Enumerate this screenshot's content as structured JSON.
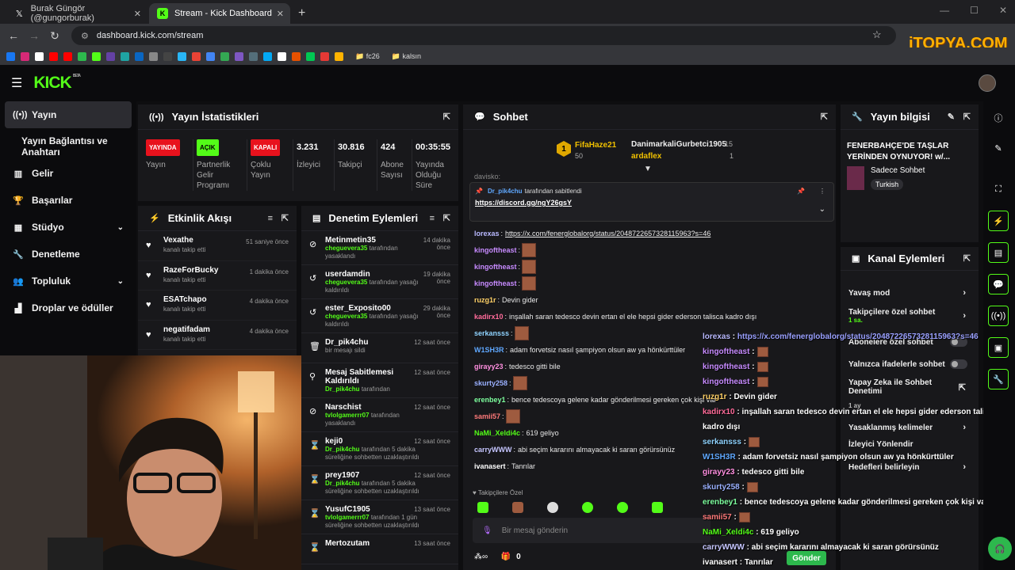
{
  "browser": {
    "tabs": [
      {
        "title": "Burak Güngör (@gungorburak)",
        "icon": "x-logo-icon"
      },
      {
        "title": "Stream - Kick Dashboard",
        "icon": "kick-logo-icon"
      }
    ],
    "url": "dashboard.kick.com/stream",
    "bookmark_folders": [
      "fc26",
      "kalsın"
    ],
    "watermark": "iTOPYA.COM"
  },
  "sidebar": {
    "items": [
      {
        "label": "Yayın",
        "icon": "broadcast-icon"
      },
      {
        "label": "Yayın Bağlantısı ve Anahtarı",
        "icon": ""
      },
      {
        "label": "Gelir",
        "icon": "revenue-icon"
      },
      {
        "label": "Başarılar",
        "icon": "trophy-icon"
      },
      {
        "label": "Stüdyo",
        "icon": "studio-icon"
      },
      {
        "label": "Denetleme",
        "icon": "wrench-icon"
      },
      {
        "label": "Topluluk",
        "icon": "community-icon"
      },
      {
        "label": "Droplar ve ödüller",
        "icon": "drops-icon"
      }
    ]
  },
  "stats_panel": {
    "title": "Yayın İstatistikleri",
    "stats": [
      {
        "badge": "YAYINDA",
        "label": "Yayın",
        "color": "#e8121d"
      },
      {
        "badge": "AÇIK",
        "label": "Partnerlik Gelir Programı",
        "color": "#53fc18"
      },
      {
        "badge": "KAPALI",
        "label": "Çoklu Yayın",
        "color": "#e8121d"
      },
      {
        "value": "3.231",
        "label": "İzleyici"
      },
      {
        "value": "30.816",
        "label": "Takipçi"
      },
      {
        "value": "424",
        "label": "Abone Sayısı"
      },
      {
        "value": "00:35:55",
        "label": "Yayında Olduğu Süre"
      }
    ]
  },
  "activity_panel": {
    "title": "Etkinlik Akışı",
    "items": [
      {
        "name": "Vexathe",
        "desc": "kanalı takip etti",
        "time": "51 saniye önce"
      },
      {
        "name": "RazeForBucky",
        "desc": "kanalı takip etti",
        "time": "1 dakika önce"
      },
      {
        "name": "ESATchapo",
        "desc": "kanalı takip etti",
        "time": "4 dakika önce"
      },
      {
        "name": "negatifadam",
        "desc": "kanalı takip etti",
        "time": "4 dakika önce"
      }
    ]
  },
  "mod_panel": {
    "title": "Denetim Eylemleri",
    "items": [
      {
        "name": "Metinmetin35",
        "mod": "cheguevera35",
        "desc": "tarafından yasaklandı",
        "time": "14 dakika önce",
        "icon": "ban-icon"
      },
      {
        "name": "userdamdin",
        "mod": "cheguevera35",
        "desc": "tarafından yasağı kaldırıldı",
        "time": "19 dakika önce",
        "icon": "undo-icon"
      },
      {
        "name": "ester_Exposito00",
        "mod": "cheguevera35",
        "desc": "tarafından yasağı kaldırıldı",
        "time": "29 dakika önce",
        "icon": "undo-icon"
      },
      {
        "name": "Dr_pik4chu",
        "mod": "",
        "desc": "bir mesajı sildi",
        "time": "12 saat önce",
        "icon": "trash-icon"
      },
      {
        "name": "Mesaj Sabitlemesi Kaldırıldı",
        "mod": "Dr_pik4chu",
        "desc": "tarafından",
        "time": "12 saat önce",
        "icon": "unpin-icon"
      },
      {
        "name": "Narschist",
        "mod": "tvlolgamerrr07",
        "desc": "tarafından yasaklandı",
        "time": "12 saat önce",
        "icon": "ban-icon"
      },
      {
        "name": "keji0",
        "mod": "Dr_pik4chu",
        "desc": "tarafından 5 dakika süreliğine sohbetten uzaklaştırıldı",
        "time": "12 saat önce",
        "icon": "hourglass-icon"
      },
      {
        "name": "prey1907",
        "mod": "Dr_pik4chu",
        "desc": "tarafından 5 dakika süreliğine sohbetten uzaklaştırıldı",
        "time": "12 saat önce",
        "icon": "hourglass-icon"
      },
      {
        "name": "YusufC1905",
        "mod": "tvlolgamerrr07",
        "desc": "tarafından 1 gün süreliğine sohbetten uzaklaştırıldı",
        "time": "13 saat önce",
        "icon": "hourglass-icon"
      },
      {
        "name": "Mertozutam",
        "mod": "",
        "desc": "",
        "time": "13 saat önce",
        "icon": "hourglass-icon"
      }
    ]
  },
  "chat_panel": {
    "title": "Sohbet",
    "leaderboard": [
      {
        "rank": "1",
        "name": "FifaHaze21",
        "count": "50"
      },
      {
        "name": "DanimarkaliGurbetci1905",
        "count": "15"
      },
      {
        "name": "ardaflex",
        "count": "1"
      }
    ],
    "pinned_by": "Dr_pik4chu",
    "pinned_by_text": "tarafından sabitlendi",
    "pinned_link": "https://discord.gg/ngY26gsY",
    "partial_top": "davisko:",
    "messages": [
      {
        "user": "lorexas",
        "text": "https://x.com/fenerglobalorg/status/2048722657328115963?s=46",
        "color": "#b9b9ff",
        "link": true
      },
      {
        "user": "kingoftheast",
        "text": "",
        "color": "#c78bff",
        "emote": true
      },
      {
        "user": "kingoftheast",
        "text": "",
        "color": "#c78bff",
        "emote": true
      },
      {
        "user": "kingoftheast",
        "text": "",
        "color": "#c78bff",
        "emote": true
      },
      {
        "user": "ruzg1r",
        "text": "Devin gider",
        "color": "#ffd166"
      },
      {
        "user": "kadirx10",
        "text": "inşallah saran tedesco devin ertan el ele hepsi gider ederson talisca kadro dışı",
        "color": "#ff6b9a"
      },
      {
        "user": "serkansss",
        "text": "",
        "color": "#8fd3ff",
        "emote": true
      },
      {
        "user": "W1SH3R",
        "text": "adam forvetsiz nasıl şampiyon olsun aw ya hönkürttüler",
        "color": "#5fa8ff"
      },
      {
        "user": "girayy23",
        "text": "tedesco gitti bile",
        "color": "#ff8fe0"
      },
      {
        "user": "skurty258",
        "text": "",
        "color": "#9ab0ff",
        "emote": true
      },
      {
        "user": "erenbey1",
        "text": "bence tedescoya gelene kadar gönderilmesi gereken çok kişi var",
        "color": "#7dff9e"
      },
      {
        "user": "samii57",
        "text": "",
        "color": "#ff7a7a",
        "emote": true
      },
      {
        "user": "NaMi_Xeldi4c",
        "text": "619 geliyo",
        "color": "#53fc18"
      },
      {
        "user": "carryWWW",
        "text": "abi seçim kararını almayacak ki saran görürsünüz",
        "color": "#c6c6ff"
      },
      {
        "user": "ivanasert",
        "text": "Tanrılar",
        "color": "#ffffff"
      }
    ],
    "followers_label": "Takipçilere Özel",
    "input_placeholder": "Bir mesaj gönderin",
    "viewer_count": "0",
    "send_label": "Gönder"
  },
  "overlay_chat": [
    {
      "user": "lorexas",
      "text": "https://x.com/fenerglobalorg/status/2048722657328115963?s=46",
      "color": "#b9b9ff"
    },
    {
      "user": "kingoftheast",
      "text": "",
      "color": "#c78bff",
      "emote": true
    },
    {
      "user": "kingoftheast",
      "text": "",
      "color": "#c78bff",
      "emote": true
    },
    {
      "user": "kingoftheast",
      "text": "",
      "color": "#c78bff",
      "emote": true
    },
    {
      "user": "ruzg1r",
      "text": "Devin gider",
      "color": "#ffd166"
    },
    {
      "user": "kadirx10",
      "text": "inşallah saran tedesco devin ertan el ele hepsi gider ederson talisca",
      "color": "#ff6b9a"
    },
    {
      "user": "",
      "text": "kadro dışı",
      "color": "#ffffff"
    },
    {
      "user": "serkansss",
      "text": "",
      "color": "#8fd3ff",
      "emote": true
    },
    {
      "user": "W1SH3R",
      "text": "adam forvetsiz nasıl şampiyon olsun aw ya hönkürttüler",
      "color": "#5fa8ff"
    },
    {
      "user": "girayy23",
      "text": "tedesco gitti bile",
      "color": "#ff8fe0"
    },
    {
      "user": "skurty258",
      "text": "",
      "color": "#9ab0ff",
      "emote": true
    },
    {
      "user": "erenbey1",
      "text": "bence tedescoya gelene kadar gönderilmesi gereken çok kişi var",
      "color": "#7dff9e"
    },
    {
      "user": "samii57",
      "text": "",
      "color": "#ff7a7a",
      "emote": true
    },
    {
      "user": "NaMi_Xeldi4c",
      "text": "619 geliyo",
      "color": "#53fc18"
    },
    {
      "user": "carryWWW",
      "text": "abi seçim kararını almayacak ki saran görürsünüz",
      "color": "#c6c6ff"
    },
    {
      "user": "ivanasert",
      "text": "Tanrılar",
      "color": "#ffffff"
    }
  ],
  "stream_info": {
    "title": "Yayın bilgisi",
    "stream_title": "FENERBAHÇE'DE TAŞLAR YERİNDEN OYNUYOR! w/...",
    "category": "Sadece Sohbet",
    "tag": "Turkish"
  },
  "channel_actions": {
    "title": "Kanal Eylemleri",
    "rows": [
      {
        "label": "Yavaş mod",
        "type": "chevron"
      },
      {
        "label": "Takipçilere özel sohbet",
        "sub": "1 sa.",
        "type": "chevron"
      },
      {
        "label": "Abonelere özel sohbet",
        "type": "toggle"
      },
      {
        "label": "Yalnızca ifadelerle sohbet",
        "type": "toggle"
      },
      {
        "label": "Yapay Zeka ile Sohbet Denetimi",
        "type": "external"
      },
      {
        "label": "1 ay",
        "type": ""
      },
      {
        "label": "Yasaklanmış kelimeler",
        "type": "chevron"
      },
      {
        "label": "İzleyici Yönlendir",
        "type": ""
      },
      {
        "label": "Hedefleri belirleyin",
        "type": "chevron"
      }
    ]
  },
  "colors": {
    "accent": "#53fc18",
    "live": "#e8121d",
    "panel": "#18181b",
    "bg": "#0e0e10"
  }
}
